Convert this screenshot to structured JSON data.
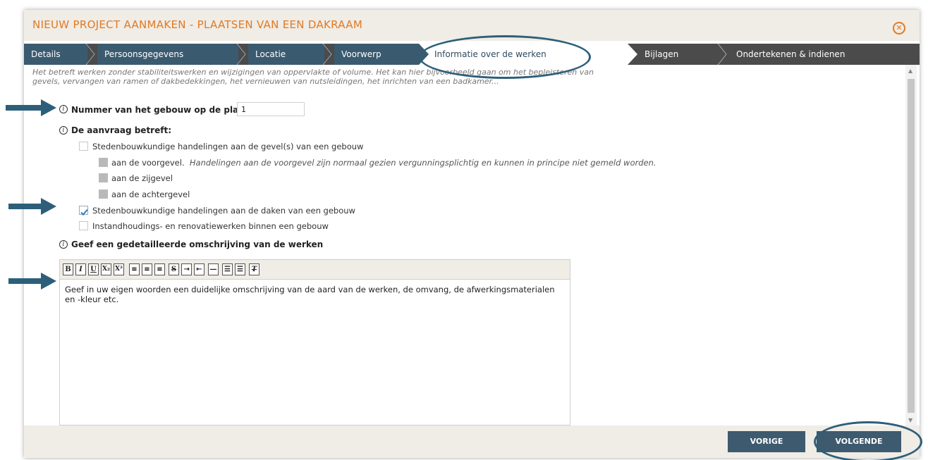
{
  "modal": {
    "title": "NIEUW PROJECT AANMAKEN - PLAATSEN VAN EEN DAKRAAM"
  },
  "steps": [
    {
      "label": "Details",
      "state": "done"
    },
    {
      "label": "Persoonsgegevens",
      "state": "done"
    },
    {
      "label": "Locatie",
      "state": "done"
    },
    {
      "label": "Voorwerp",
      "state": "done"
    },
    {
      "label": "Informatie over de werken",
      "state": "active"
    },
    {
      "label": "Bijlagen",
      "state": "todo"
    },
    {
      "label": "Ondertekenen & indienen",
      "state": "todo"
    }
  ],
  "intro": "Het betreft werken zonder stabiliteitswerken en wijzigingen van oppervlakte of volume. Het kan hier bijvoorbeeld gaan om het bepleisteren van gevels, vervangen van ramen of dakbedekkingen, het vernieuwen van nutsleidingen, het inrichten van een badkamer...",
  "form": {
    "building_number": {
      "label": "Nummer van het gebouw op de plannen",
      "value": "1"
    },
    "request": {
      "label": "De aanvraag betreft:",
      "options": [
        {
          "label": "Stedenbouwkundige handelingen aan de gevel(s) van een gebouw",
          "checked": false
        },
        {
          "label": "aan de voorgevel.",
          "note": "Handelingen aan de voorgevel zijn normaal gezien vergunningsplichtig en kunnen in principe niet gemeld worden.",
          "disabled": true
        },
        {
          "label": "aan de zijgevel",
          "disabled": true
        },
        {
          "label": "aan de achtergevel",
          "disabled": true
        },
        {
          "label": "Stedenbouwkundige handelingen aan de daken van een gebouw",
          "checked": true
        },
        {
          "label": "Instandhoudings- en renovatiewerken binnen een gebouw",
          "checked": false
        }
      ]
    },
    "description": {
      "label": "Geef een gedetailleerde omschrijving van de werken",
      "text": "Geef in uw eigen woorden een duidelijke omschrijving van de aard van de werken, de omvang, de afwerkingsmaterialen en -kleur etc."
    }
  },
  "toolbar": {
    "buttons": [
      {
        "glyph": "B",
        "icon": "bold-icon"
      },
      {
        "glyph": "I",
        "icon": "italic-icon"
      },
      {
        "glyph": "U",
        "icon": "underline-icon"
      },
      {
        "glyph": "X₂",
        "icon": "subscript-icon"
      },
      {
        "glyph": "X²",
        "icon": "superscript-icon"
      },
      {
        "glyph": "≡",
        "icon": "align-left-icon"
      },
      {
        "glyph": "≡",
        "icon": "align-center-icon"
      },
      {
        "glyph": "≡",
        "icon": "align-right-icon"
      },
      {
        "glyph": "S",
        "icon": "strikethrough-icon"
      },
      {
        "glyph": "⇥",
        "icon": "indent-icon"
      },
      {
        "glyph": "⇤",
        "icon": "outdent-icon"
      },
      {
        "glyph": "—",
        "icon": "horizontal-rule-icon"
      },
      {
        "glyph": "☰",
        "icon": "numbered-list-icon"
      },
      {
        "glyph": "☰",
        "icon": "bulleted-list-icon"
      },
      {
        "glyph": "T",
        "icon": "remove-format-icon"
      }
    ]
  },
  "footer": {
    "prev_label": "VORIGE",
    "next_label": "VOLGENDE"
  },
  "colors": {
    "accent": "#e07a23",
    "nav_bg": "#4b4b4b",
    "nav_done": "#3a5a70",
    "button": "#3e5a6f",
    "annotation": "#2d5f7a"
  }
}
